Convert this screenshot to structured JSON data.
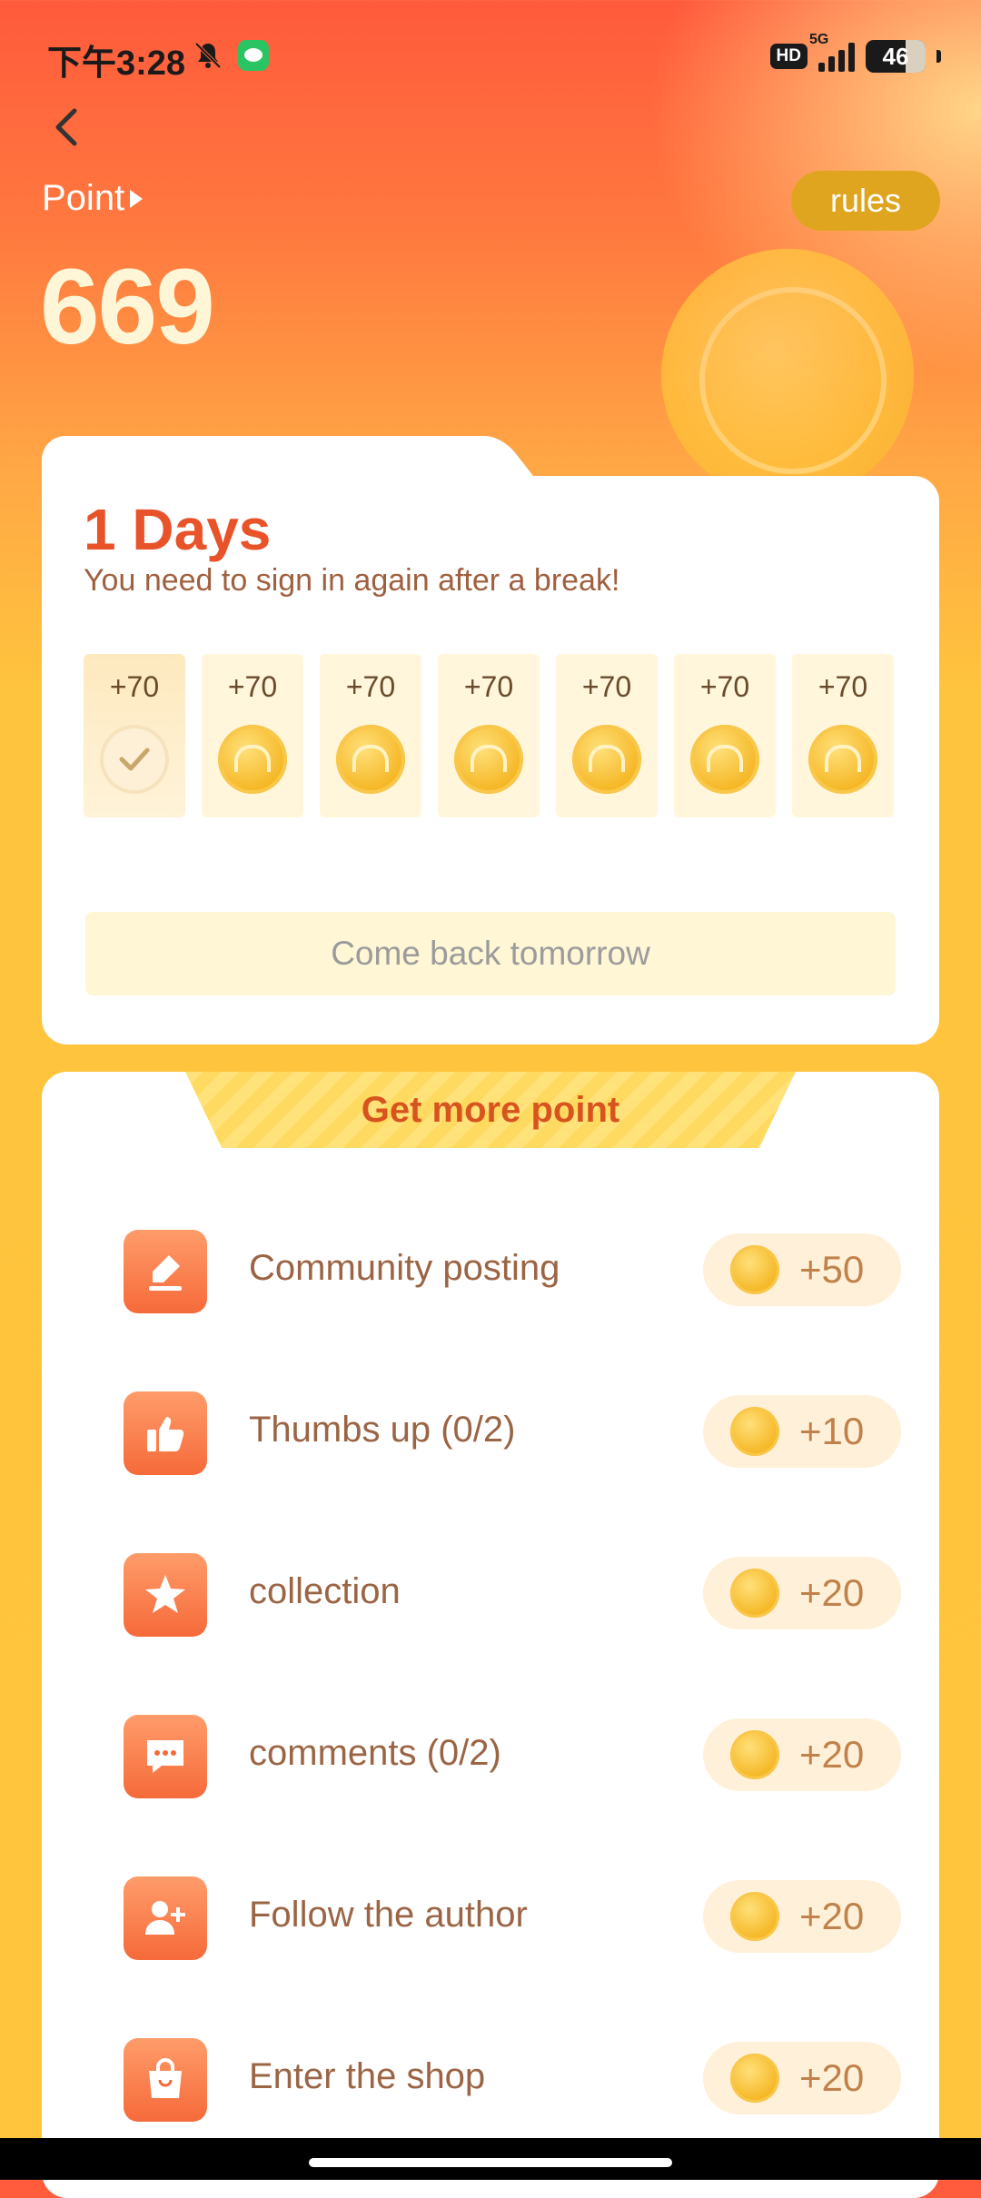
{
  "status_bar": {
    "time": "下午3:28",
    "network_badge": "HD",
    "network_type": "5G",
    "battery": "46"
  },
  "header": {
    "point_label": "Point",
    "point_value": "669",
    "rules_label": "rules"
  },
  "sign_in": {
    "days_title": "1 Days",
    "hint": "You need to sign in again after a break!",
    "days": [
      {
        "amount": "+70",
        "done": true
      },
      {
        "amount": "+70",
        "done": false
      },
      {
        "amount": "+70",
        "done": false
      },
      {
        "amount": "+70",
        "done": false
      },
      {
        "amount": "+70",
        "done": false
      },
      {
        "amount": "+70",
        "done": false
      },
      {
        "amount": "+70",
        "done": false
      }
    ],
    "button_label": "Come back tomorrow"
  },
  "tasks": {
    "banner_title": "Get more point",
    "items": [
      {
        "label": "Community posting",
        "reward": "+50",
        "icon": "edit-icon"
      },
      {
        "label": "Thumbs up (0/2)",
        "reward": "+10",
        "icon": "thumbs-up-icon"
      },
      {
        "label": "collection",
        "reward": "+20",
        "icon": "star-icon"
      },
      {
        "label": "comments (0/2)",
        "reward": "+20",
        "icon": "comment-icon"
      },
      {
        "label": "Follow the author",
        "reward": "+20",
        "icon": "add-user-icon"
      },
      {
        "label": "Enter the shop",
        "reward": "+20",
        "icon": "shopping-bag-icon"
      }
    ]
  },
  "colors": {
    "accent": "#e8532a",
    "rules_button": "#e0a51e",
    "task_icon": "#f66a3a",
    "card": "#ffffff"
  }
}
